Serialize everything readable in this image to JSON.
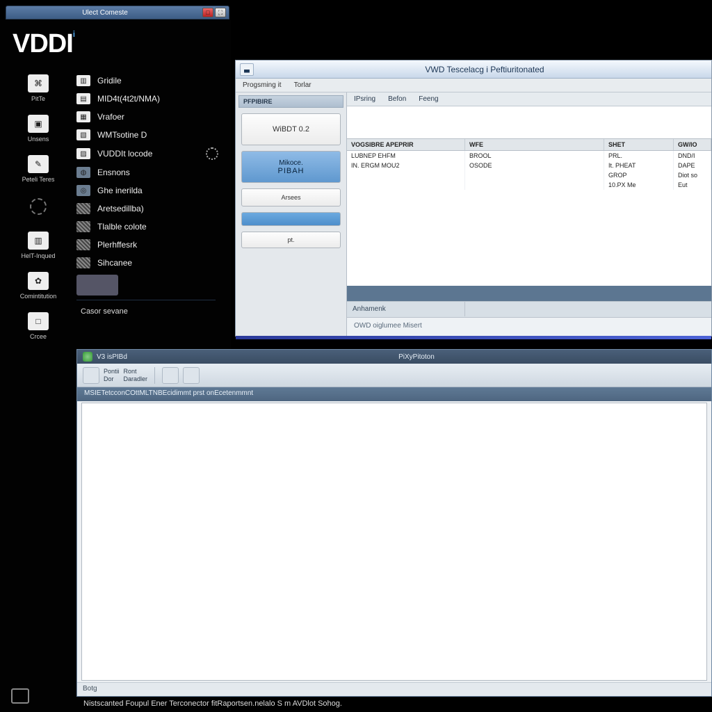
{
  "topbar": {
    "title": "Ulect Comeste"
  },
  "logo": "VDDI",
  "sidebar": {
    "left_icons": [
      {
        "icon": "⌘",
        "label": "PitTe"
      },
      {
        "icon": "▣",
        "label": "Unsens"
      },
      {
        "icon": "✎",
        "label": "Peteli Teres"
      },
      {
        "icon": "",
        "label": ""
      },
      {
        "icon": "▥",
        "label": "HelT-Inqued"
      },
      {
        "icon": "✿",
        "label": "Comintitution"
      },
      {
        "icon": "□",
        "label": "Crcee"
      }
    ],
    "items": [
      "Gridile",
      "MID4t(4t2t/NMA)",
      "Vrafoer",
      "WMTsotine D",
      "VUDDIt locode",
      "Ensnons",
      "Ghe inerilda",
      "Aretsedillba)",
      "Tlalble colote",
      "Plerhffesrk",
      "Sihcanee"
    ],
    "casor": "Casor sevane"
  },
  "win1": {
    "title": "VWD Tescelacg i Peftiuritonated",
    "menu": [
      "Progsming it",
      "Torlar"
    ],
    "panel_head": "PFPIBIRE",
    "tile_main": "WiBDT 0.2",
    "tile_blue_a": "Mikoce.",
    "tile_blue_b": "PIBAH",
    "tile_small": "Arsees",
    "tile_mini": "pt.",
    "tabs": [
      "IPsring",
      "Befon",
      "Feeng"
    ],
    "headers": [
      "VOGSIBRE APEPRIR",
      "WFE",
      "SHET",
      "GW/IO"
    ],
    "row1": [
      "LUBNEP EHFM",
      "BROOL",
      "PRL.",
      "DND/I"
    ],
    "row2": [
      "IN. ERGM MOU2",
      "OSODE",
      "It. PHEAT",
      "DAPE"
    ],
    "row3": [
      "",
      "",
      "GROP",
      "Diot so"
    ],
    "row4": [
      "",
      "",
      "10.PX Me",
      "Eut"
    ],
    "label_cell": "Anhamenk",
    "footer": "OWD oiglumee Misert"
  },
  "win2": {
    "left_title": "V3 isPIBd",
    "center_title": "PiXyPitoton",
    "tool_a1": "Pontii",
    "tool_a2": "Dor",
    "tool_b1": "Ront",
    "tool_b2": "Daradler",
    "info": "MSIETetcconCOttMLTNBEcidimmt prst onEcetenmmnt",
    "status": "Botg"
  },
  "footer": "Nistscanted Foupul Ener Terconector fitRaportsen.nelalo S m AVDlot Sohog."
}
